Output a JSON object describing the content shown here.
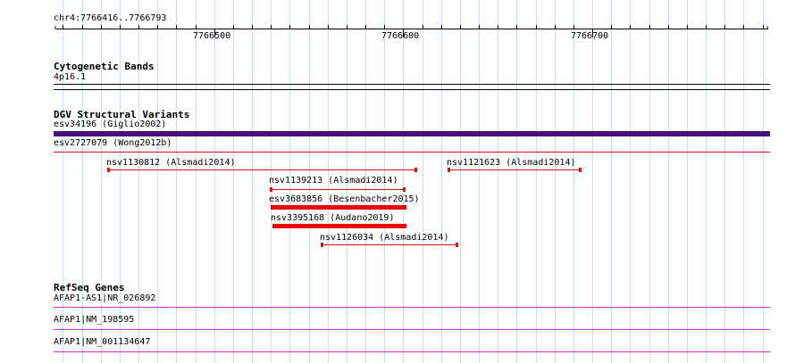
{
  "ruler": {
    "range": "chr4:7766416..7766793",
    "start": 7766416,
    "end": 7766793,
    "major_ticks": [
      {
        "pos": 7766500,
        "label": "7766500"
      },
      {
        "pos": 7766600,
        "label": "7766600"
      },
      {
        "pos": 7766700,
        "label": "7766700"
      }
    ]
  },
  "tracks": {
    "cytoband": {
      "title": "Cytogenetic Bands",
      "band": "4p16.1"
    },
    "dgv": {
      "title": "DGV Structural Variants",
      "features": [
        {
          "label": "esv34196 (Giglio2002)",
          "start": 7766416,
          "end": 7766793,
          "style": "thick",
          "color": "#4b0f7c"
        },
        {
          "label": "esv2727079 (Wong2012b)",
          "start": 7766416,
          "end": 7766793,
          "style": "line",
          "color": "#dd1111"
        },
        {
          "label": "nsv1130812 (Alsmadi2014)",
          "start": 7766444,
          "end": 7766607,
          "style": "range",
          "color": "#dd1111"
        },
        {
          "label": "nsv1121623 (Alsmadi2014)",
          "start": 7766624,
          "end": 7766694,
          "style": "range",
          "color": "#dd1111"
        },
        {
          "label": "nsv1139213 (Alsmadi2014)",
          "start": 7766530,
          "end": 7766601,
          "style": "range",
          "color": "#dd1111"
        },
        {
          "label": "esv3683856 (Besenbacher2015)",
          "start": 7766530,
          "end": 7766602,
          "style": "bar",
          "color": "#ee0000"
        },
        {
          "label": "nsv3395168 (Audano2019)",
          "start": 7766531,
          "end": 7766602,
          "style": "bar",
          "color": "#ee0000"
        },
        {
          "label": "nsv1126034 (Alsmadi2014)",
          "start": 7766557,
          "end": 7766629,
          "style": "range",
          "color": "#dd1111"
        }
      ]
    },
    "refseq": {
      "title": "RefSeq Genes",
      "color": "#cc33cc",
      "genes": [
        {
          "label": "AFAP1-AS1|NR_026892"
        },
        {
          "label": "AFAP1|NM_198595"
        },
        {
          "label": "AFAP1|NM_001134647"
        }
      ]
    }
  }
}
